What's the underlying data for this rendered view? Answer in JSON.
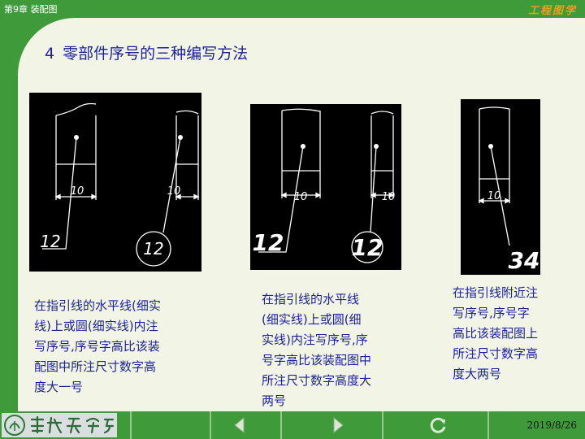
{
  "header": {
    "chapter": "第9章 装配图",
    "course": "工程图学"
  },
  "heading": {
    "number": "4",
    "text": "零部件序号的三种编写方法"
  },
  "panels": [
    {
      "dimension_labels": [
        "10",
        "10"
      ],
      "balloon_labels": [
        "12",
        "12"
      ]
    },
    {
      "dimension_labels": [
        "10",
        "10"
      ],
      "balloon_labels": [
        "12",
        "12"
      ]
    },
    {
      "dimension_labels": [
        "10"
      ],
      "balloon_labels": [
        "34"
      ]
    }
  ],
  "descriptions": [
    "在指引线的水平线(细实\n线)上或圆(细实线)内注\n写序号,序号字高比该装\n配图中所注尺寸数字高\n度大一号",
    "在指引线的水平线\n(细实线)上或圆(细\n实线)内注写序号,序\n号字高比该装配图中\n所注尺寸数字高度大\n两号",
    "在指引线附近注\n写序号,序号字\n高比该装配图上\n所注尺寸数字高\n度大两号"
  ],
  "footer": {
    "date": "2019/8/26",
    "prev_icon": "triangle-left-icon",
    "next_icon": "triangle-right-icon",
    "return_icon": "return-arrow-icon"
  },
  "colors": {
    "frame_green": "#3f9b3a",
    "slide_bg": "#f2f5e6",
    "text_blue": "#1b1f9a",
    "course_orange": "#e8a020"
  }
}
